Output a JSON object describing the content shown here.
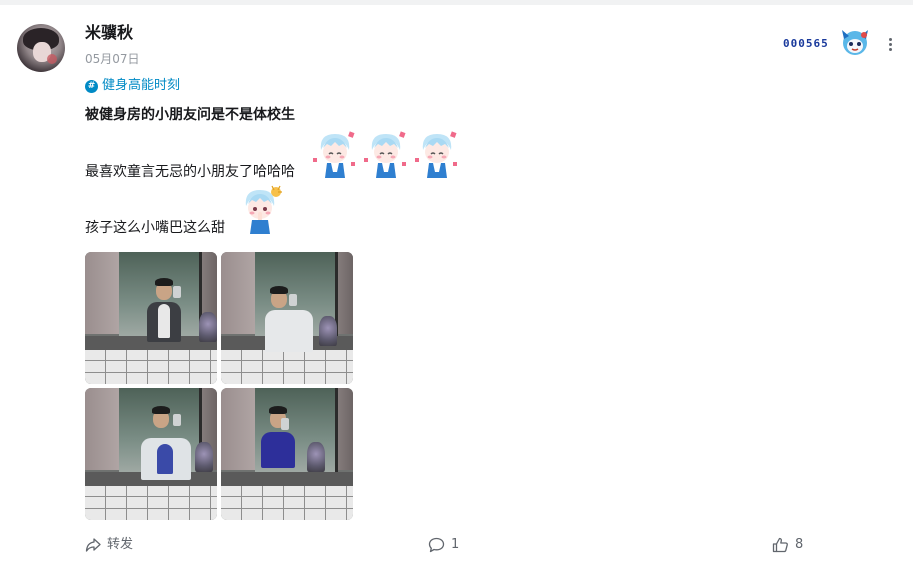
{
  "post": {
    "author": {
      "name": "米骥秋"
    },
    "date": "05月07日",
    "fan_badge": {
      "number": "000565",
      "icon": "mascot-badge-icon"
    },
    "topic": {
      "label": "健身高能时刻",
      "icon": "hashtag-icon"
    },
    "content": {
      "line1": "被健身房的小朋友问是不是体校生",
      "line2": "最喜欢童言无忌的小朋友了哈哈哈",
      "line3": "孩子这么小嘴巴这么甜"
    },
    "stickers": {
      "line2": [
        "chibi-happy-sticker",
        "chibi-happy-sticker",
        "chibi-happy-sticker"
      ],
      "line3": [
        "chibi-shush-sticker"
      ]
    },
    "images": [
      {
        "name": "mirror-selfie-1"
      },
      {
        "name": "mirror-selfie-2"
      },
      {
        "name": "mirror-selfie-3"
      },
      {
        "name": "mirror-selfie-4"
      }
    ],
    "actions": {
      "forward": {
        "label": "转发",
        "icon": "share-icon"
      },
      "comment": {
        "count": "1",
        "icon": "comment-icon"
      },
      "like": {
        "count": "8",
        "icon": "thumbs-up-icon"
      }
    }
  },
  "colors": {
    "topic": "#008ac5",
    "text": "#18191c",
    "muted": "#9499a0",
    "action": "#61666d",
    "badge": "#1a3a9c"
  }
}
